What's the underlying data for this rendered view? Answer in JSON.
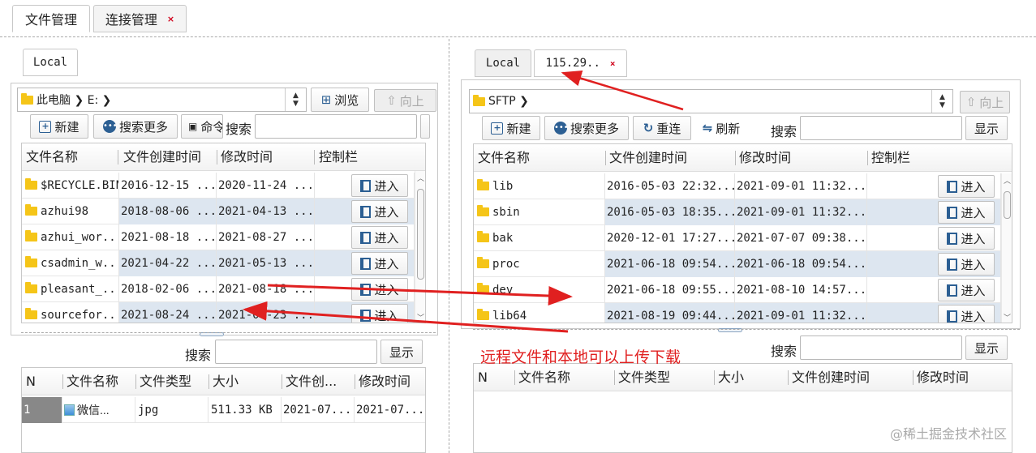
{
  "top_tabs": [
    {
      "label": "文件管理"
    },
    {
      "label": "连接管理",
      "close": "×"
    }
  ],
  "left": {
    "tab": "Local",
    "path": "此电脑 ❯ E: ❯",
    "browse": "浏览",
    "up": "向上",
    "toolbar": {
      "new": "新建",
      "search_more": "搜索更多",
      "cmd": "命令",
      "search": "搜索"
    },
    "columns": [
      "文件名称",
      "文件创建时间",
      "修改时间",
      "控制栏"
    ],
    "rows": [
      {
        "name": "$RECYCLE.BIN",
        "created": "2016-12-15 ...",
        "modified": "2020-11-24 ...",
        "action": "进入"
      },
      {
        "name": "azhui98",
        "created": "2018-08-06 ...",
        "modified": "2021-04-13 ...",
        "action": "进入"
      },
      {
        "name": "azhui_wor...",
        "created": "2021-08-18 ...",
        "modified": "2021-08-27 ...",
        "action": "进入"
      },
      {
        "name": "csadmin_w...",
        "created": "2021-04-22 ...",
        "modified": "2021-05-13 ...",
        "action": "进入"
      },
      {
        "name": "pleasant_...",
        "created": "2018-02-06 ...",
        "modified": "2021-08-18 ...",
        "action": "进入"
      },
      {
        "name": "sourcefor...",
        "created": "2021-08-24 ...",
        "modified": "2021-08-23 ...",
        "action": "进入"
      }
    ],
    "lower": {
      "search": "搜索",
      "show": "显示",
      "columns": [
        "N",
        "文件名称",
        "文件类型",
        "大小",
        "文件创...",
        "修改时间"
      ],
      "rows": [
        {
          "n": "1",
          "name": "微信...",
          "type": "jpg",
          "size": "511.33 KB",
          "created": "2021-07...",
          "modified": "2021-07..."
        }
      ]
    }
  },
  "right": {
    "tabs": [
      {
        "label": "Local"
      },
      {
        "label": "115.29..",
        "close": "×"
      }
    ],
    "path": "SFTP ❯",
    "up": "向上",
    "toolbar": {
      "new": "新建",
      "search_more": "搜索更多",
      "reconnect": "重连",
      "refresh": "刷新",
      "search": "搜索",
      "show": "显示"
    },
    "columns": [
      "文件名称",
      "文件创建时间",
      "修改时间",
      "控制栏"
    ],
    "rows": [
      {
        "name": "lib",
        "created": "2016-05-03 22:32...",
        "modified": "2021-09-01 11:32...",
        "action": "进入"
      },
      {
        "name": "sbin",
        "created": "2016-05-03 18:35...",
        "modified": "2021-09-01 11:32...",
        "action": "进入"
      },
      {
        "name": "bak",
        "created": "2020-12-01 17:27...",
        "modified": "2021-07-07 09:38...",
        "action": "进入"
      },
      {
        "name": "proc",
        "created": "2021-06-18 09:54...",
        "modified": "2021-06-18 09:54...",
        "action": "进入"
      },
      {
        "name": "dev",
        "created": "2021-06-18 09:55...",
        "modified": "2021-08-10 14:57...",
        "action": "进入"
      },
      {
        "name": "lib64",
        "created": "2021-08-19 09:44...",
        "modified": "2021-09-01 11:32...",
        "action": "进入"
      }
    ],
    "lower": {
      "search": "搜索",
      "show": "显示",
      "columns": [
        "N",
        "文件名称",
        "文件类型",
        "大小",
        "文件创建时间",
        "修改时间"
      ]
    }
  },
  "annotation": "远程文件和本地可以上传下载",
  "watermark": "@稀土掘金技术社区",
  "colors": {
    "annotation": "#e02020",
    "highlight": "#dde6f0",
    "icon": "#2c5f93",
    "folder": "#f5c518"
  }
}
